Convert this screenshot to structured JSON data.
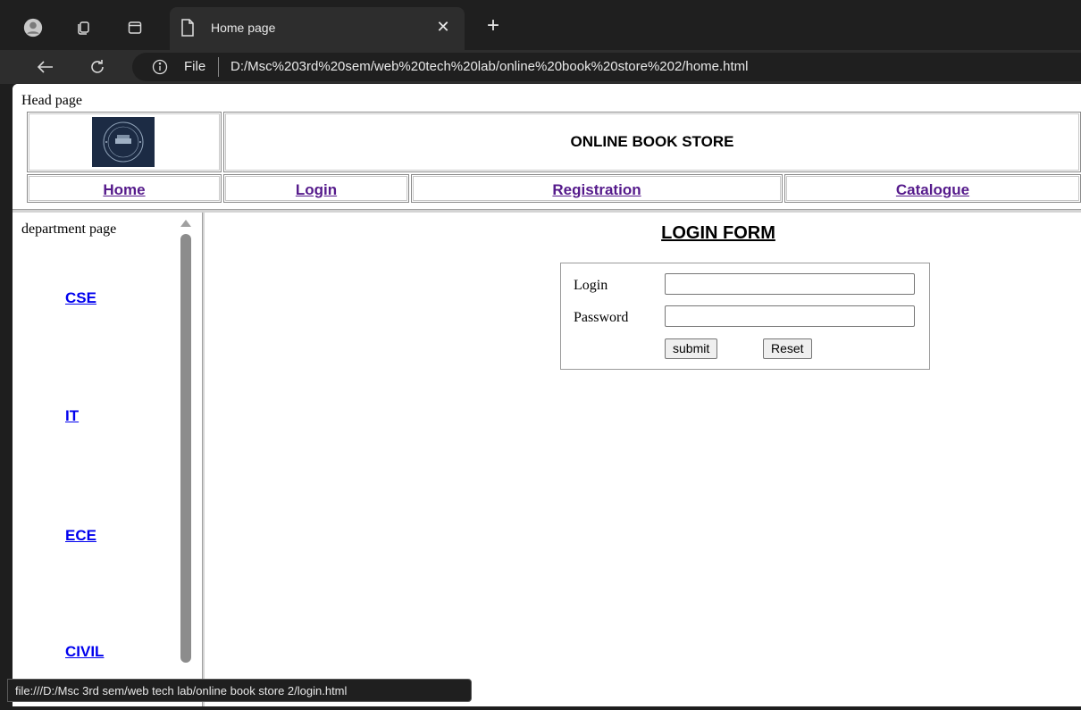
{
  "browser": {
    "tab_title": "Home page",
    "info_label": "File",
    "url": "D:/Msc%203rd%20sem/web%20tech%20lab/online%20book%20store%202/home.html",
    "status_url": "file:///D:/Msc 3rd sem/web tech lab/online book store 2/login.html"
  },
  "head": {
    "label": "Head page",
    "store_title": "ONLINE BOOK STORE",
    "logo_text_top": "BOOK STORE",
    "logo_text_bottom": "SAM'S",
    "nav": [
      "Home",
      "Login",
      "Registration",
      "Catalogue"
    ]
  },
  "department": {
    "label": "department page",
    "links": [
      "CSE",
      "IT",
      "ECE",
      "CIVIL"
    ]
  },
  "login_form": {
    "title": "LOGIN FORM",
    "login_label": "Login",
    "password_label": "Password",
    "login_value": "",
    "password_value": "",
    "submit_label": "submit",
    "reset_label": "Reset"
  }
}
